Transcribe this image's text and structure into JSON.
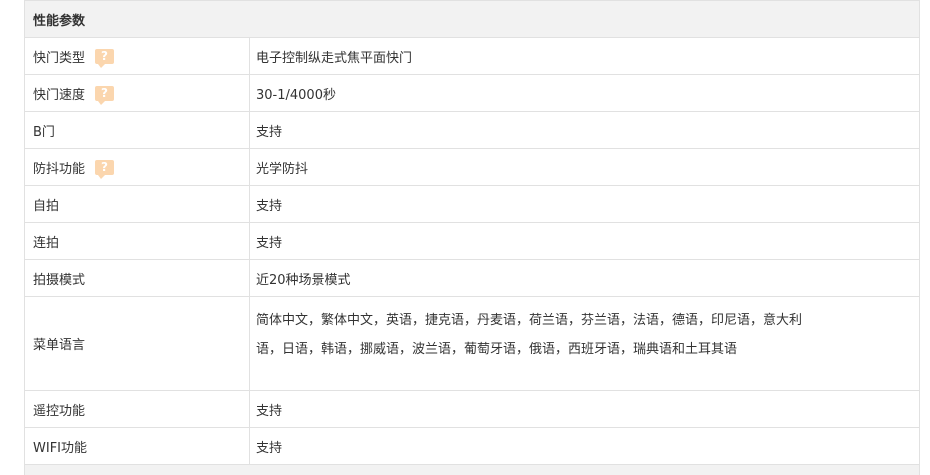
{
  "section": {
    "title": "性能参数"
  },
  "rows": [
    {
      "label": "快门类型",
      "value": "电子控制纵走式焦平面快门",
      "help": true
    },
    {
      "label": "快门速度",
      "value": "30-1/4000秒",
      "help": true
    },
    {
      "label": "B门",
      "value": "支持",
      "help": false
    },
    {
      "label": "防抖功能",
      "value": "光学防抖",
      "help": true
    },
    {
      "label": "自拍",
      "value": "支持",
      "help": false
    },
    {
      "label": "连拍",
      "value": "支持",
      "help": false
    },
    {
      "label": "拍摄模式",
      "value": "近20种场景模式",
      "help": false
    },
    {
      "label": "菜单语言",
      "value": "简体中文，繁体中文，英语，捷克语，丹麦语，荷兰语，芬兰语，法语，德语，印尼语，意大利语，日语，韩语，挪威语，波兰语，葡萄牙语，俄语，西班牙语，瑞典语和土耳其语",
      "help": false
    },
    {
      "label": "遥控功能",
      "value": "支持",
      "help": false
    },
    {
      "label": "WIFI功能",
      "value": "支持",
      "help": false
    }
  ],
  "icons": {
    "help": "help-question-icon",
    "help_glyph": "?",
    "help_color": "#fbd6ae"
  }
}
